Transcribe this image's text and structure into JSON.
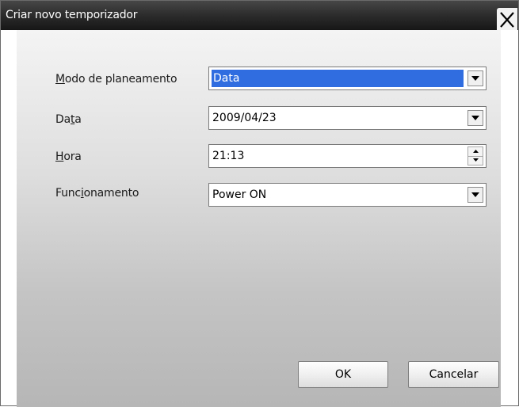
{
  "window": {
    "title": "Criar novo temporizador"
  },
  "form": {
    "mode": {
      "label_accel": "M",
      "label_rest": "odo de planeamento",
      "value": "Data"
    },
    "date": {
      "label_pre": "Da",
      "label_accel": "t",
      "label_post": "a",
      "value": "2009/04/23"
    },
    "time": {
      "label_accel": "H",
      "label_rest": "ora",
      "value": "21:13"
    },
    "operation": {
      "label_pre": "Func",
      "label_accel": "i",
      "label_post": "onamento",
      "value": "Power ON"
    }
  },
  "buttons": {
    "ok": "OK",
    "cancel": "Cancelar"
  },
  "colors": {
    "titlebar_top": "#474747",
    "titlebar_bottom": "#161616",
    "selection": "#2f6de0"
  },
  "icons": {
    "close": "close-icon",
    "dropdown": "chevron-down-icon",
    "spin_up": "spin-up-icon",
    "spin_down": "spin-down-icon"
  }
}
